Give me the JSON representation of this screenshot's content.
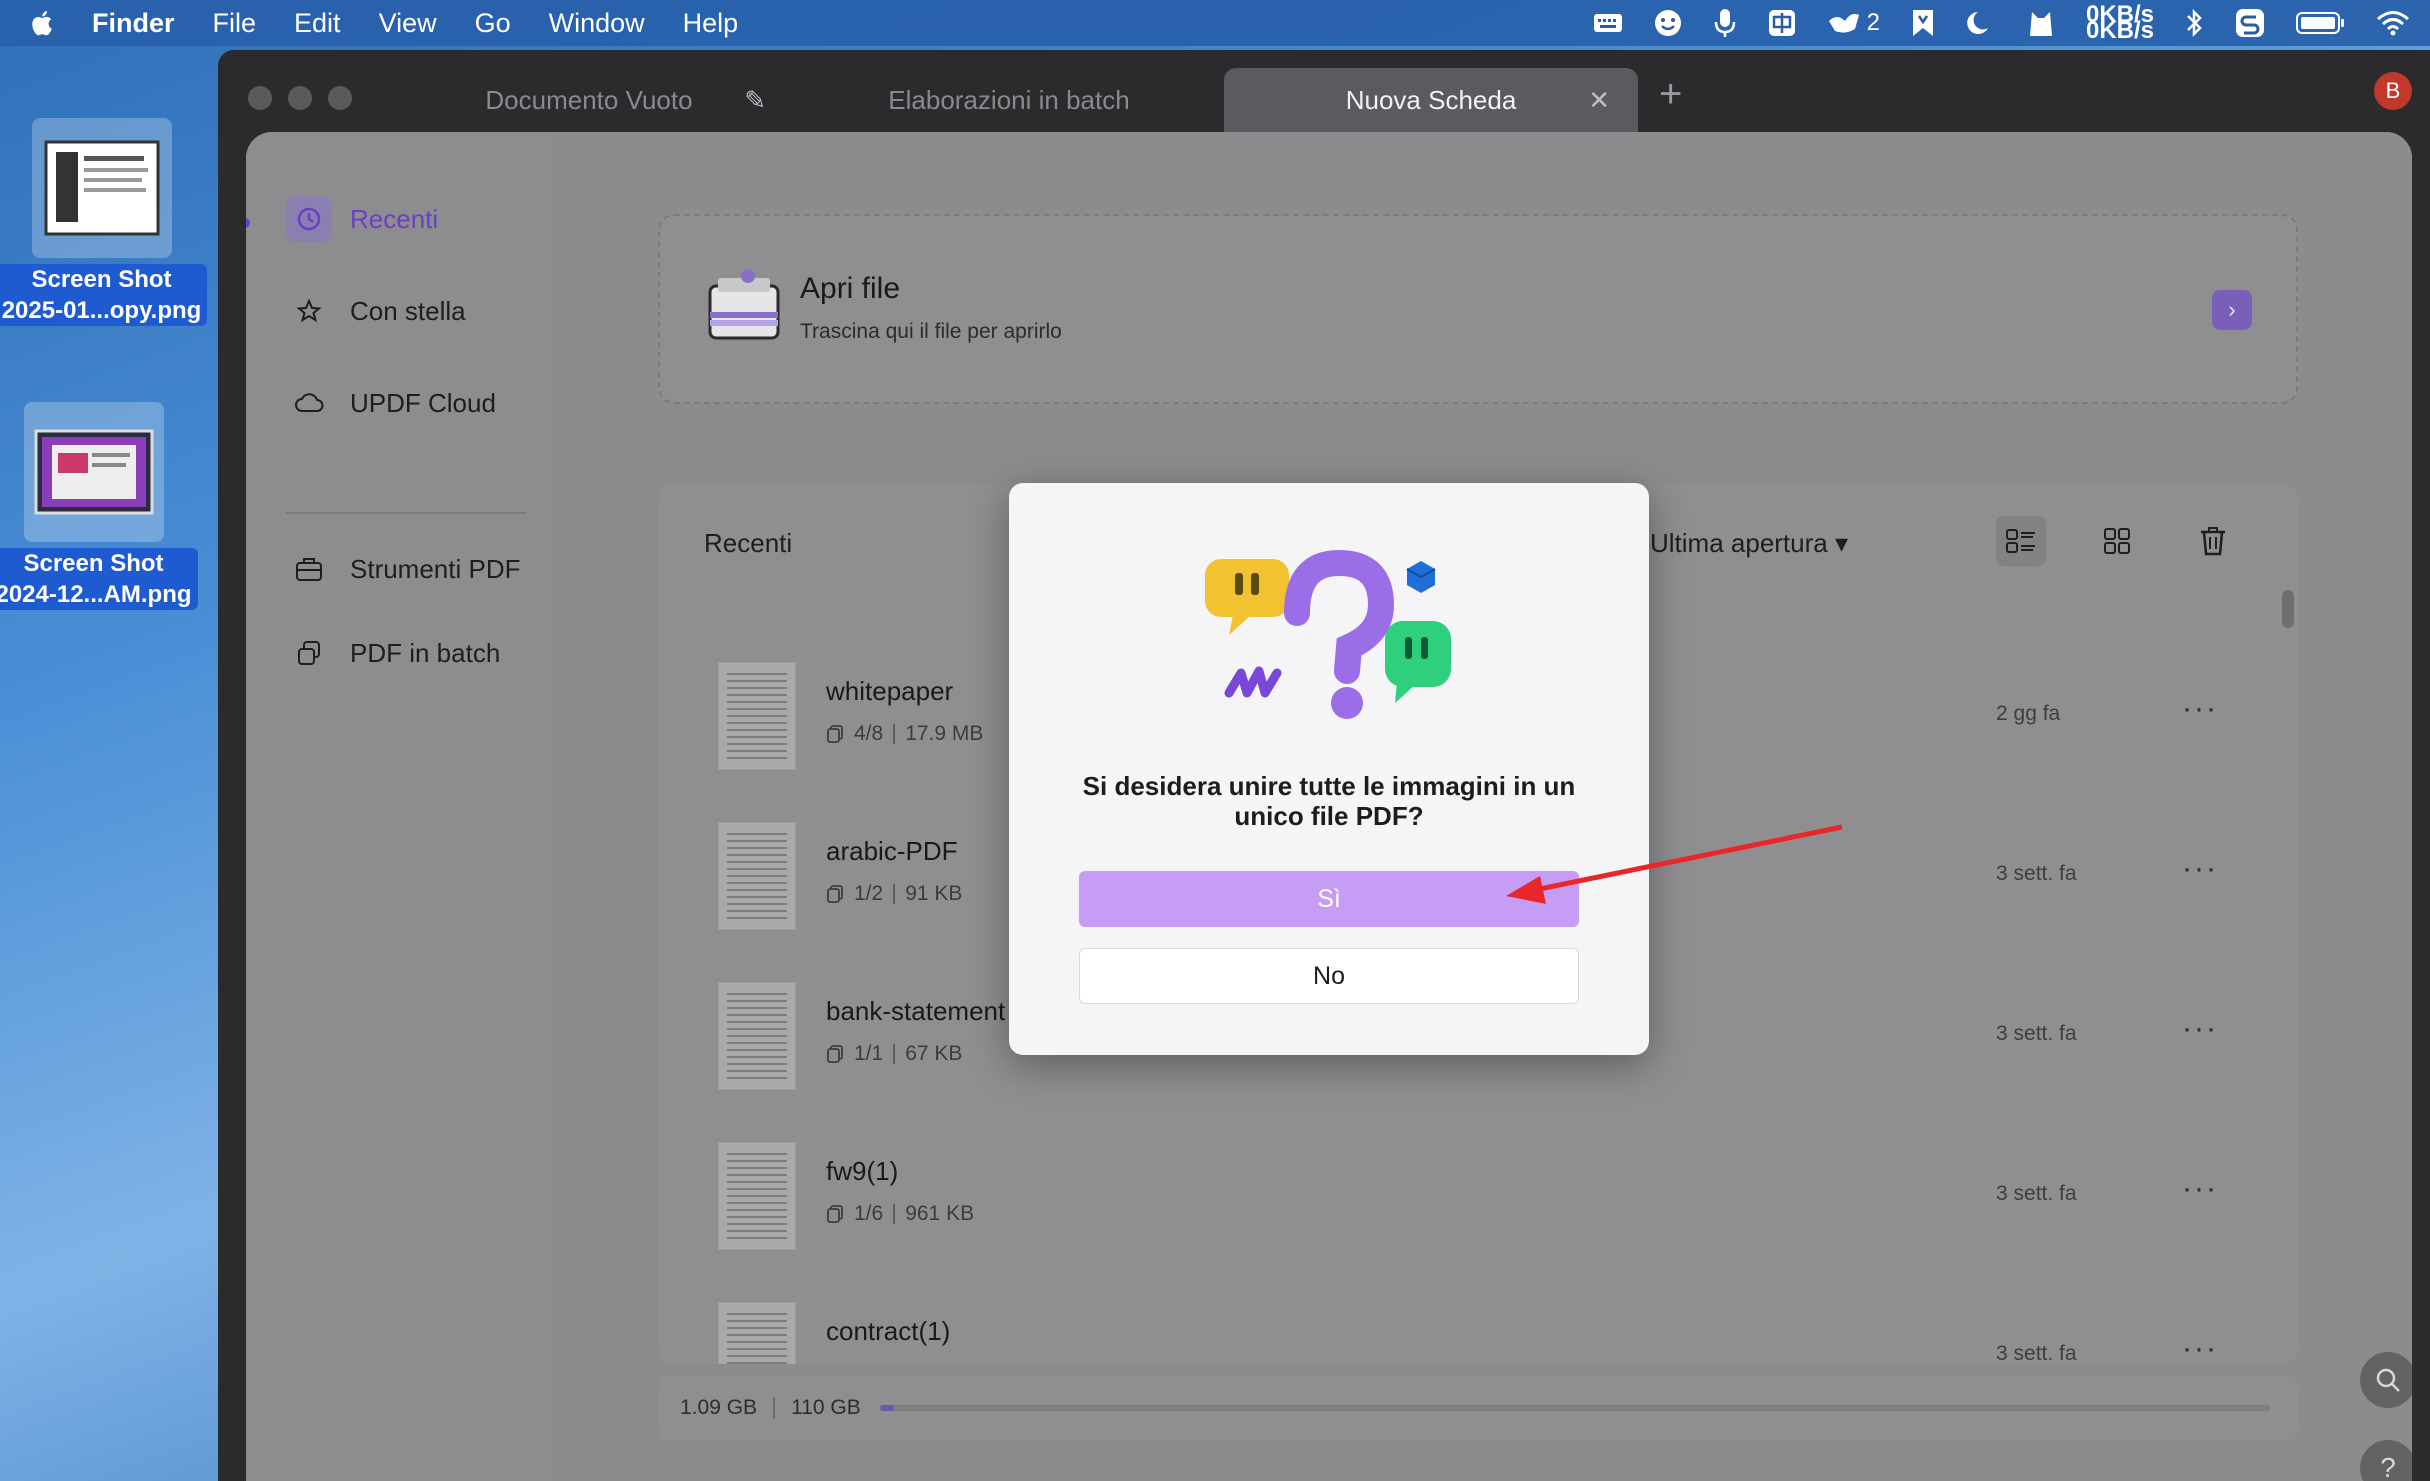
{
  "menubar": {
    "items": [
      "Finder",
      "File",
      "Edit",
      "View",
      "Go",
      "Window",
      "Help"
    ],
    "status_badge_count": "2",
    "net_up": "0KB/s",
    "net_down": "0KB/s",
    "icons": [
      "apple-icon",
      "keyboard-icon",
      "face-icon",
      "microphone-icon",
      "input-method-icon",
      "ink-icon",
      "bookmark-icon",
      "moon-icon",
      "cat-icon",
      "bluetooth-icon",
      "sync-icon",
      "battery-icon",
      "wifi-icon"
    ]
  },
  "desktop": {
    "icons": [
      {
        "line1": "Screen Shot",
        "line2": "2025-01...opy.png"
      },
      {
        "line1": "Screen Shot",
        "line2": "2024-12...AM.png"
      }
    ]
  },
  "tabs": [
    {
      "label": "Documento Vuoto",
      "extra": "✎"
    },
    {
      "label": "Elaborazioni in batch",
      "extra": ""
    },
    {
      "label": "Nuova Scheda",
      "extra": "✕"
    }
  ],
  "add_tab": "+",
  "avatar_letter": "B",
  "sidebar": {
    "items": [
      {
        "label": "Recenti",
        "icon": "clock-icon"
      },
      {
        "label": "Con stella",
        "icon": "star-icon"
      },
      {
        "label": "UPDF Cloud",
        "icon": "cloud-icon"
      },
      {
        "label": "Strumenti PDF",
        "icon": "toolbox-icon"
      },
      {
        "label": "PDF in batch",
        "icon": "batch-icon"
      }
    ]
  },
  "open_file": {
    "title": "Apri file",
    "subtitle": "Trascina qui il file per aprirlo",
    "chevron": "›"
  },
  "recent": {
    "header": "Recenti",
    "sort_label": "Ultima apertura ▾",
    "files": [
      {
        "name": "whitepaper",
        "pages": "4/8",
        "size": "17.9 MB",
        "when": "2 gg fa"
      },
      {
        "name": "arabic-PDF",
        "pages": "1/2",
        "size": "91 KB",
        "when": "3 sett. fa"
      },
      {
        "name": "bank-statement",
        "pages": "1/1",
        "size": "67 KB",
        "when": "3 sett. fa"
      },
      {
        "name": "fw9(1)",
        "pages": "1/6",
        "size": "961 KB",
        "when": "3 sett. fa"
      },
      {
        "name": "contract(1)",
        "pages": "",
        "size": "",
        "when": "3 sett. fa"
      }
    ],
    "more_label": "···"
  },
  "storage": {
    "used": "1.09 GB",
    "total": "110 GB",
    "fill_fraction": 0.01
  },
  "fabs": {
    "search": "⌕",
    "help": "?"
  },
  "dialog": {
    "question": "Si desidera unire tutte le immagini in un unico file PDF?",
    "yes_label": "Sì",
    "no_label": "No",
    "accent": "#c69cf5"
  },
  "annotation": {
    "arrow_color": "#e8272a"
  }
}
